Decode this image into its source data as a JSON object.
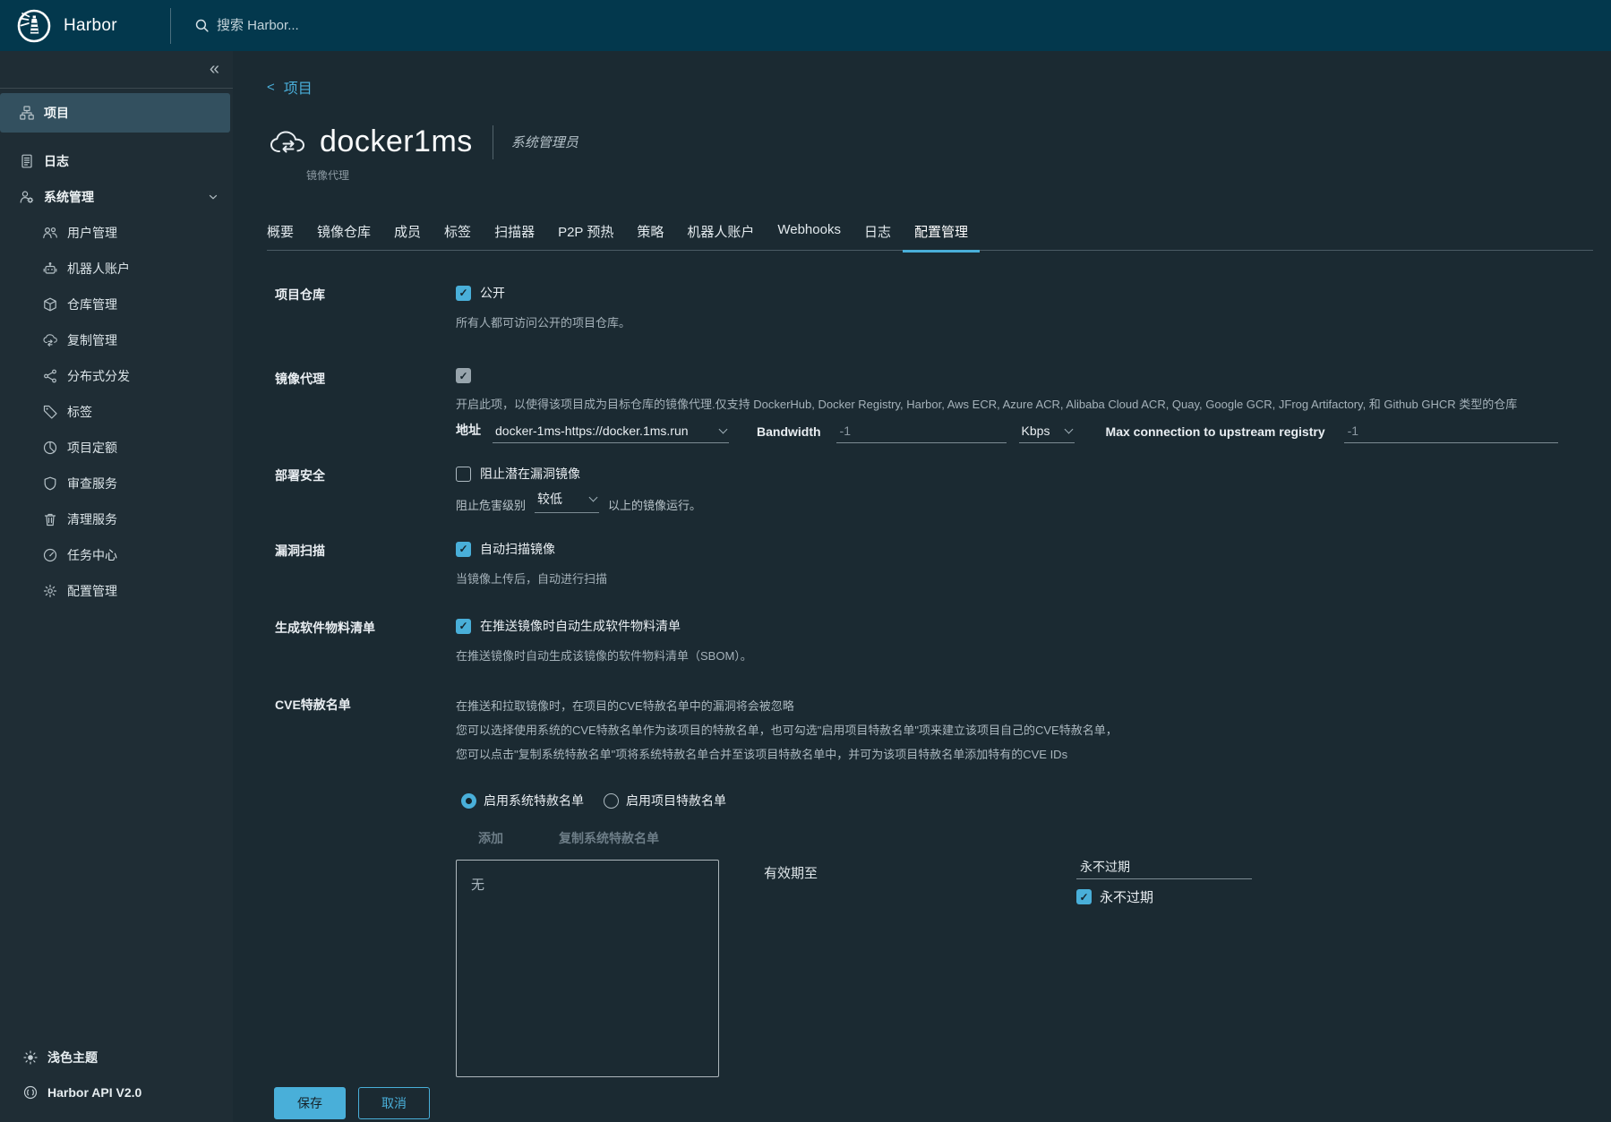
{
  "colors": {
    "accent": "#49afd9",
    "header_bg": "#03384d",
    "content_bg": "#1b2a32"
  },
  "header": {
    "brand": "Harbor",
    "search_placeholder": "搜索 Harbor..."
  },
  "sidebar": {
    "collapse_icon": "«",
    "items": [
      {
        "label": "项目",
        "active": true
      },
      {
        "label": "日志"
      },
      {
        "label": "系统管理",
        "expanded": true
      }
    ],
    "admin_children": [
      {
        "label": "用户管理"
      },
      {
        "label": "机器人账户"
      },
      {
        "label": "仓库管理"
      },
      {
        "label": "复制管理"
      },
      {
        "label": "分布式分发"
      },
      {
        "label": "标签"
      },
      {
        "label": "项目定额"
      },
      {
        "label": "审查服务"
      },
      {
        "label": "清理服务"
      },
      {
        "label": "任务中心"
      },
      {
        "label": "配置管理"
      }
    ],
    "footer": [
      {
        "label": "浅色主题"
      },
      {
        "label": "Harbor API V2.0"
      }
    ]
  },
  "main": {
    "breadcrumb": {
      "back_icon": "<",
      "label": "项目"
    },
    "project": {
      "name": "docker1ms",
      "role": "系统管理员",
      "type_label": "镜像代理"
    },
    "tabs": [
      {
        "label": "概要"
      },
      {
        "label": "镜像仓库"
      },
      {
        "label": "成员"
      },
      {
        "label": "标签"
      },
      {
        "label": "扫描器"
      },
      {
        "label": "P2P 预热"
      },
      {
        "label": "策略"
      },
      {
        "label": "机器人账户"
      },
      {
        "label": "Webhooks"
      },
      {
        "label": "日志"
      },
      {
        "label": "配置管理",
        "active": true
      }
    ],
    "form": {
      "project_repo": {
        "label": "项目仓库",
        "checkbox": "公开",
        "checked": true,
        "desc": "所有人都可访问公开的项目仓库。"
      },
      "proxy": {
        "label": "镜像代理",
        "checked": true,
        "desc": "开启此项，以使得该项目成为目标仓库的镜像代理.仅支持 DockerHub, Docker Registry, Harbor, Aws ECR, Azure ACR, Alibaba Cloud ACR, Quay, Google GCR, JFrog Artifactory, 和 Github GHCR 类型的仓库",
        "endpoint_label": "地址",
        "endpoint_value": "docker-1ms-https://docker.1ms.run",
        "bandwidth_label": "Bandwidth",
        "bandwidth_value": "-1",
        "bandwidth_unit": "Kbps",
        "max_conn_label": "Max connection to upstream registry",
        "max_conn_value": "-1"
      },
      "deployment_security": {
        "label": "部署安全",
        "checkbox": "阻止潜在漏洞镜像",
        "checked": false,
        "severity_prefix": "阻止危害级别",
        "severity_value": "较低",
        "severity_suffix": "以上的镜像运行。"
      },
      "vulnerability_scan": {
        "label": "漏洞扫描",
        "checkbox": "自动扫描镜像",
        "checked": true,
        "desc": "当镜像上传后，自动进行扫描"
      },
      "sbom": {
        "label": "生成软件物料清单",
        "checkbox": "在推送镜像时自动生成软件物料清单",
        "checked": true,
        "desc": "在推送镜像时自动生成该镜像的软件物料清单（SBOM）。"
      },
      "cve": {
        "label": "CVE特赦名单",
        "desc_lines": [
          "在推送和拉取镜像时，在项目的CVE特赦名单中的漏洞将会被忽略",
          "您可以选择使用系统的CVE特赦名单作为该项目的特赦名单，也可勾选\"启用项目特赦名单\"项来建立该项目自己的CVE特赦名单，",
          "您可以点击\"复制系统特赦名单\"项将系统特赦名单合并至该项目特赦名单中，并可为该项目特赦名单添加特有的CVE IDs"
        ],
        "radio_system": "启用系统特赦名单",
        "radio_project": "启用项目特赦名单",
        "selected_radio": "system",
        "add_button": "添加",
        "copy_button": "复制系统特赦名单",
        "list_value": "无",
        "expires_label": "有效期至",
        "expires_value": "永不过期",
        "never_expires_checkbox": "永不过期",
        "never_expires_checked": true
      }
    },
    "actions": {
      "save": "保存",
      "cancel": "取消"
    }
  }
}
